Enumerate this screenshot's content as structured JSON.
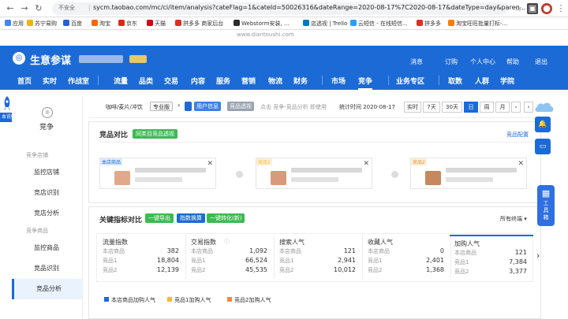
{
  "browser": {
    "security_label": "不安全",
    "url": "sycm.taobao.com/mc/ci/item/analysis?cateFlag=1&cateId=50026316&dateRange=2020-08-17%7C2020-08-17&dateType=day&paren...",
    "bookmarks": [
      "应用",
      "苏宁易购",
      "百度",
      "淘宝",
      "京东",
      "天猫",
      "拼多多 商家后台",
      "Webstorm安装, ...",
      "店透视 | Trello",
      "云短信 - 在线短信...",
      "拼多多",
      "淘宝旺旺批量打标-..."
    ]
  },
  "watermark": "www.diantoushi.com",
  "header": {
    "brand": "生意参谋",
    "links": [
      "消息",
      "订购",
      "个人中心",
      "帮助",
      "退出"
    ],
    "nav": [
      "首页",
      "实时",
      "作战室",
      "流量",
      "品类",
      "交易",
      "内容",
      "服务",
      "营销",
      "物流",
      "财务",
      "市场",
      "竞争",
      "业务专区",
      "取数",
      "人群",
      "学院"
    ],
    "active_nav": "竞争"
  },
  "side_tag": "本说明",
  "sidebar": {
    "title": "竞争",
    "groups": [
      {
        "label": "竞争店铺",
        "items": [
          "监控店铺",
          "竞店识别",
          "竞店分析"
        ]
      },
      {
        "label": "竞争商品",
        "items": [
          "监控商品",
          "竞品识别",
          "竞品分析"
        ]
      }
    ],
    "active_item": "竞品分析"
  },
  "toolbar": {
    "category": "咖啡/麦片/冲饮",
    "edition": "专业版",
    "user_info": "用户信息",
    "perspective": "竞品透视",
    "hint": "点击 竞争-竞品分析 即使用",
    "stat_time": "统计时间 2020-08-17",
    "ranges": [
      "实时",
      "7天",
      "30天",
      "日",
      "周",
      "月"
    ],
    "active_range": "日"
  },
  "compare": {
    "title": "竞品对比",
    "perspective_btn": "同类目竞品透视",
    "config_link": "竞品配置",
    "slots": [
      {
        "tag": "本店商品",
        "thumb": "#e0a98c"
      },
      {
        "tag": "竞品1",
        "thumb": "#d99a7b"
      },
      {
        "tag": "竞品2",
        "thumb": "#c6885c"
      }
    ]
  },
  "kpi": {
    "title": "关键指标对比",
    "buttons": [
      "一键导出",
      "指数换算",
      "一键转化(新)"
    ],
    "terminal": "所有终端",
    "row_labels": [
      "本店商品",
      "竞品1",
      "竞品2"
    ],
    "metrics": [
      {
        "name": "流量指数",
        "values": [
          "382",
          "18,804",
          "12,139"
        ]
      },
      {
        "name": "交易指数",
        "values": [
          "1,092",
          "66,524",
          "45,535"
        ]
      },
      {
        "name": "搜索人气",
        "values": [
          "121",
          "2,941",
          "10,012"
        ]
      },
      {
        "name": "收藏人气",
        "values": [
          "0",
          "2,401",
          "1,368"
        ]
      },
      {
        "name": "加购人气",
        "values": [
          "121",
          "7,384",
          "3,377"
        ]
      }
    ]
  },
  "legend": [
    "本店商品加购人气",
    "竞品1加购人气",
    "竞品2加购人气"
  ],
  "toolbox": "工具箱",
  "colors": {
    "brand_blue": "#1c6ad6",
    "green": "#3cba54",
    "legend": [
      "#1c6ad6",
      "#f5b83d",
      "#f08b3c"
    ]
  }
}
